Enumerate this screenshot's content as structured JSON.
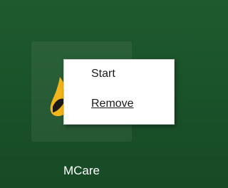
{
  "desktop": {
    "background_color": "#1c542b",
    "shortcut": {
      "label": "MCare",
      "icon": "mcare-app-icon"
    }
  },
  "context_menu": {
    "items": [
      {
        "label": "Start"
      },
      {
        "label": "Remove"
      }
    ]
  }
}
